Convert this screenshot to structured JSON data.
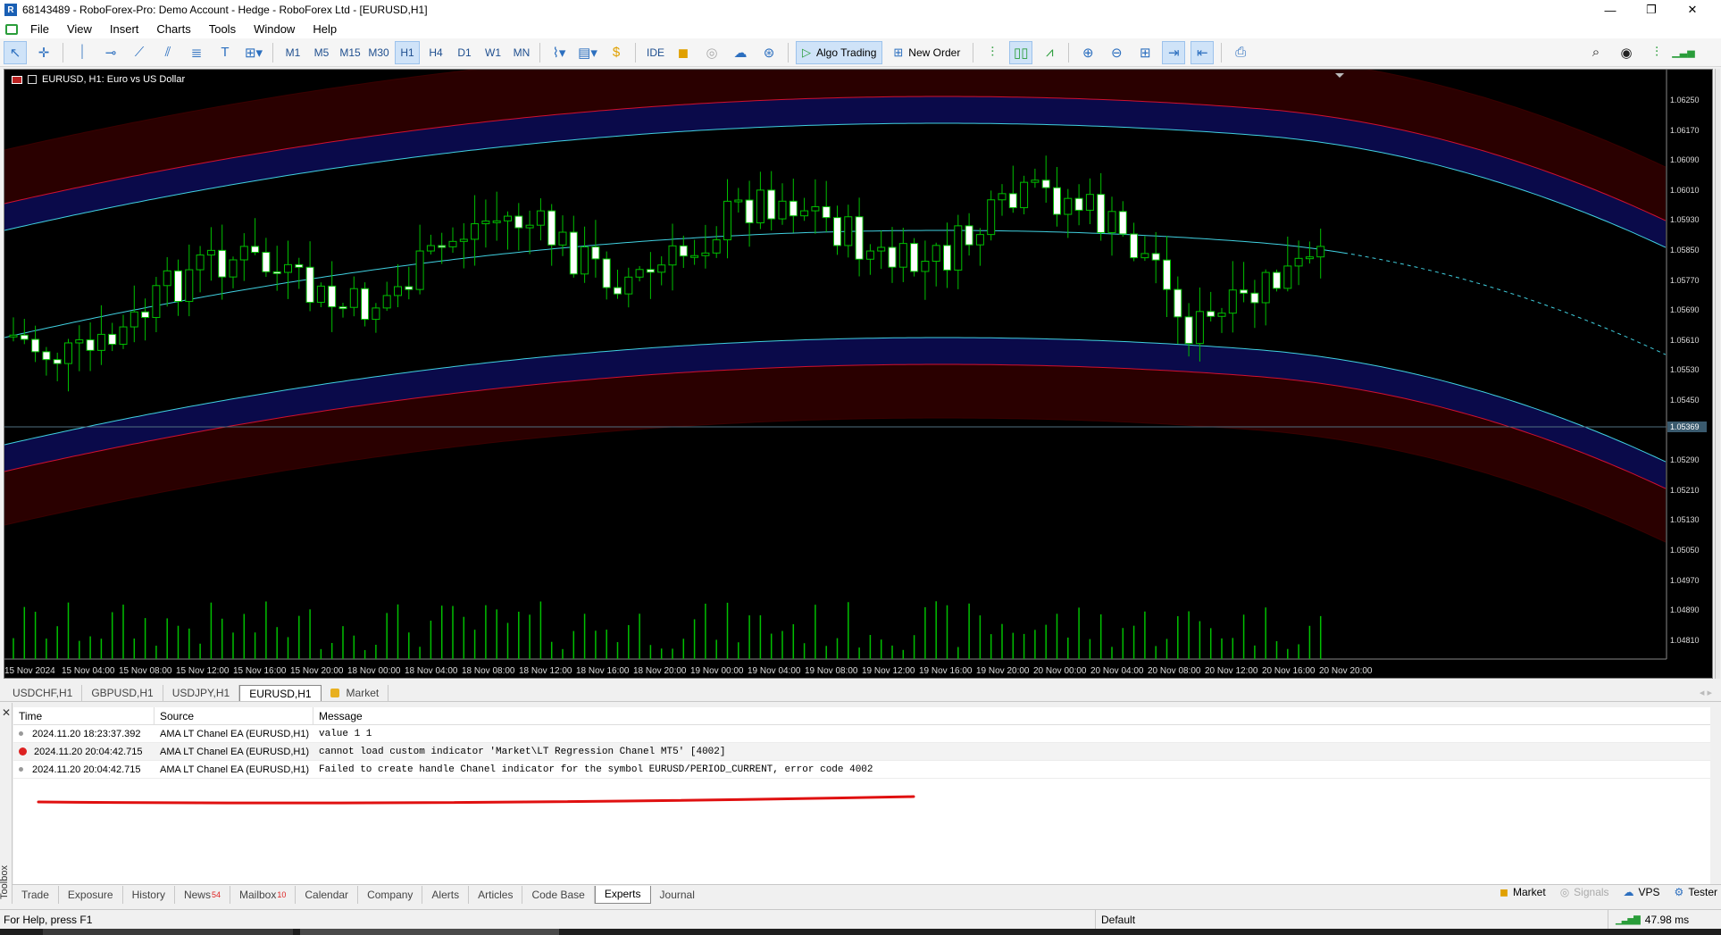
{
  "window": {
    "title": "68143489 - RoboForex-Pro: Demo Account - Hedge - RoboForex Ltd - [EURUSD,H1]",
    "minimize": "—",
    "restore": "❐",
    "close": "✕"
  },
  "menu": [
    "File",
    "View",
    "Insert",
    "Charts",
    "Tools",
    "Window",
    "Help"
  ],
  "toolbar": {
    "timeframes": [
      "M1",
      "M5",
      "M15",
      "M30",
      "H1",
      "H4",
      "D1",
      "W1",
      "MN"
    ],
    "active_timeframe": "H1",
    "ide_label": "IDE",
    "algo_trading_label": "Algo Trading",
    "new_order_label": "New Order"
  },
  "chart": {
    "title": "EURUSD, H1:  Euro vs US Dollar",
    "current_price": "1.05369",
    "price_labels": [
      "1.06250",
      "1.06170",
      "1.06090",
      "1.06010",
      "1.05930",
      "1.05850",
      "1.05770",
      "1.05690",
      "1.05610",
      "1.05530",
      "1.05450",
      "1.05369",
      "1.05290",
      "1.05210",
      "1.05130",
      "1.05050",
      "1.04970",
      "1.04890",
      "1.04810"
    ],
    "time_labels": [
      "15 Nov 2024",
      "15 Nov 04:00",
      "15 Nov 08:00",
      "15 Nov 12:00",
      "15 Nov 16:00",
      "15 Nov 20:00",
      "18 Nov 00:00",
      "18 Nov 04:00",
      "18 Nov 08:00",
      "18 Nov 12:00",
      "18 Nov 16:00",
      "18 Nov 20:00",
      "19 Nov 00:00",
      "19 Nov 04:00",
      "19 Nov 08:00",
      "19 Nov 12:00",
      "19 Nov 16:00",
      "19 Nov 20:00",
      "20 Nov 00:00",
      "20 Nov 04:00",
      "20 Nov 08:00",
      "20 Nov 12:00",
      "20 Nov 16:00",
      "20 Nov 20:00"
    ],
    "colors": {
      "background": "#000000",
      "bull": "#00c000",
      "bear": "#ffffff",
      "outer_band": "#2a0000",
      "inner_band": "#0a0a4a",
      "outer_line": "#d01030",
      "mid_line": "#40d0e0",
      "volume": "#00c000"
    }
  },
  "chart_tabs": [
    "USDCHF,H1",
    "GBPUSD,H1",
    "USDJPY,H1",
    "EURUSD,H1",
    "Market"
  ],
  "active_chart_tab": "EURUSD,H1",
  "toolbox": {
    "label": "Toolbox",
    "close": "✕",
    "columns": [
      "Time",
      "Source",
      "Message"
    ],
    "rows": [
      {
        "time": "2024.11.20 18:23:37.392",
        "source": "AMA LT Chanel EA (EURUSD,H1)",
        "message": "value 1  1",
        "level": "info"
      },
      {
        "time": "2024.11.20 20:04:42.715",
        "source": "AMA LT Chanel EA (EURUSD,H1)",
        "message": "cannot load custom indicator 'Market\\LT Regression Chanel MT5' [4002]",
        "level": "error"
      },
      {
        "time": "2024.11.20 20:04:42.715",
        "source": "AMA LT Chanel EA (EURUSD,H1)",
        "message": "Failed to create handle Chanel indicator for the symbol EURUSD/PERIOD_CURRENT, error code 4002",
        "level": "info"
      }
    ]
  },
  "bottom_tabs": [
    {
      "label": "Trade"
    },
    {
      "label": "Exposure"
    },
    {
      "label": "History"
    },
    {
      "label": "News",
      "badge": "54"
    },
    {
      "label": "Mailbox",
      "badge": "10"
    },
    {
      "label": "Calendar"
    },
    {
      "label": "Company"
    },
    {
      "label": "Alerts"
    },
    {
      "label": "Articles"
    },
    {
      "label": "Code Base"
    },
    {
      "label": "Experts"
    },
    {
      "label": "Journal"
    }
  ],
  "active_bottom_tab": "Experts",
  "right_tabs": {
    "market": "Market",
    "signals": "Signals",
    "vps": "VPS",
    "tester": "Tester"
  },
  "status": {
    "help": "For Help, press F1",
    "profile": "Default",
    "ping": "47.98 ms"
  }
}
